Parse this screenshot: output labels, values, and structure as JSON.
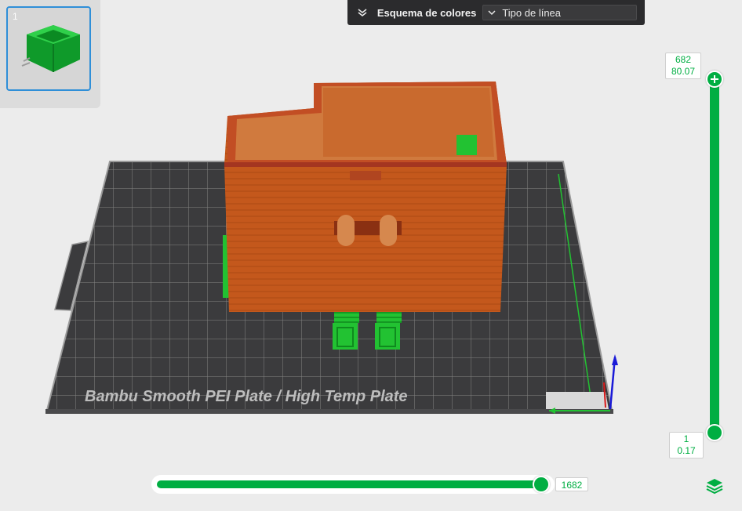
{
  "toolbar": {
    "color_scheme_label": "Esquema de colores",
    "line_type_value": "Tipo de línea"
  },
  "plate_list": {
    "plate_number": "1"
  },
  "viewport": {
    "bed_label": "Bambu Smooth PEI Plate / High Temp Plate"
  },
  "layer_slider": {
    "top_layer": "682",
    "top_height": "80.07",
    "bottom_layer": "1",
    "bottom_height": "0.17"
  },
  "move_slider": {
    "value": "1682"
  },
  "colors": {
    "accent": "#00ae42",
    "model_orange": "#c4581c",
    "model_green": "#22c232",
    "bed": "#3b3b3d",
    "topbar": "#2b2b2d"
  },
  "icons": [
    "collapse-icon",
    "chevron-down-icon",
    "plus-icon",
    "layers-icon"
  ]
}
